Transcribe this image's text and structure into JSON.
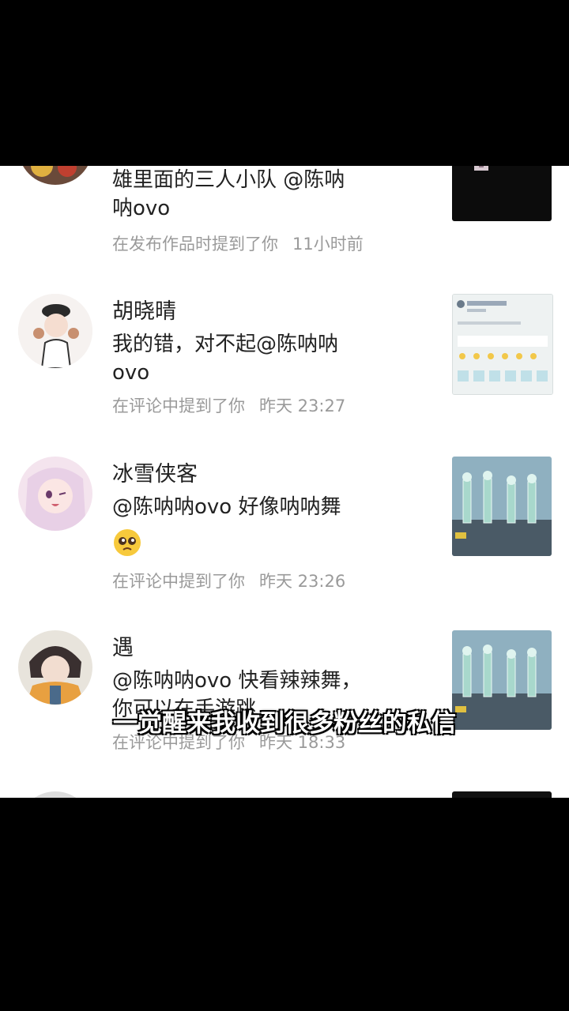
{
  "notifications": [
    {
      "text_lines": [
        "雄里面的三人小队 @陈呐",
        "呐ovo"
      ],
      "meta": "在发布作品时提到了你",
      "time": "11小时前"
    },
    {
      "name": "胡晓晴",
      "text_lines": [
        "我的错，对不起@陈呐呐",
        "ovo"
      ],
      "meta": "在评论中提到了你",
      "time": "昨天 23:27"
    },
    {
      "name": "冰雪侠客",
      "text_lines": [
        "@陈呐呐ovo 好像呐呐舞"
      ],
      "emoji": "pleading-face",
      "meta": "在评论中提到了你",
      "time": "昨天 23:26"
    },
    {
      "name": "遇",
      "text_lines": [
        "@陈呐呐ovo 快看辣辣舞，",
        "你可以在手游跳"
      ],
      "meta": "在评论中提到了你",
      "time": "昨天 18:33"
    }
  ],
  "subtitle": "一觉醒来我收到很多粉丝的私信",
  "colors": {
    "background": "#000000",
    "panel": "#ffffff",
    "meta_text": "#9a9a9a"
  }
}
